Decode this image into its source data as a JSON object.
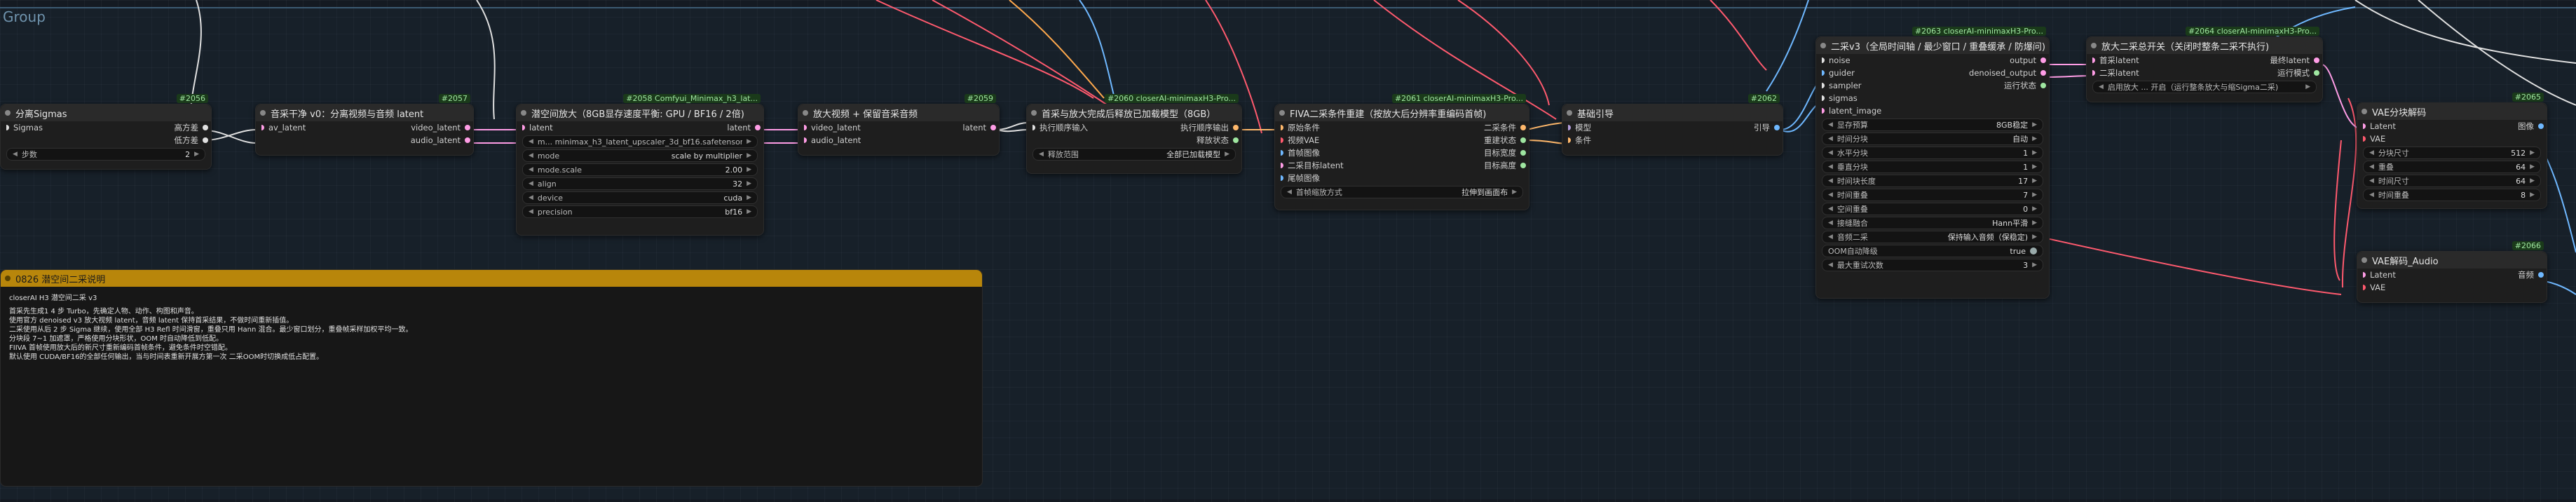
{
  "group": {
    "title": "Group"
  },
  "nodes": {
    "sigmas": {
      "id": "#2056",
      "title": "分离Sigmas",
      "in": "Sigmas",
      "out": [
        "高方差",
        "低方差"
      ],
      "widget": {
        "label": "步数",
        "value": "2"
      }
    },
    "audio_sep": {
      "id": "#2057",
      "title": "音采干净 v0：分离视频与音频 latent",
      "in": "av_latent",
      "out": [
        "video_latent",
        "audio_latent"
      ]
    },
    "upscale": {
      "id": "#2058 Comfyui_Minimax_h3_lat...",
      "title": "潜空间放大（8GB显存速度平衡: GPU / BF16 / 2倍)",
      "in": "latent",
      "out": "latent",
      "widgets": [
        {
          "label": "m... minimax_h3_latent_upscaler_3d_bf16.safetensors",
          "value": ""
        },
        {
          "label": "mode",
          "value": "scale by multiplier"
        },
        {
          "label": "mode.scale",
          "value": "2.00"
        },
        {
          "label": "align",
          "value": "32"
        },
        {
          "label": "device",
          "value": "cuda"
        },
        {
          "label": "precision",
          "value": "bf16"
        }
      ]
    },
    "merge": {
      "id": "#2059",
      "title": "放大视频 + 保留音采音频",
      "in": [
        "video_latent",
        "audio_latent"
      ],
      "out": "latent"
    },
    "unload": {
      "id": "#2060 closerAI-minimaxH3-Pro...",
      "title": "首采与放大完成后释放已加载模型（8GB）",
      "in": "执行顺序输入",
      "out": [
        "执行顺序输出",
        "释放状态"
      ],
      "widget": {
        "label": "释放范围",
        "value": "全部已加载模型"
      }
    },
    "cond": {
      "id": "#2061 closerAI-minimaxH3-Pro...",
      "title": "FIVA二采条件重建（按放大后分辨率重编码首帧)",
      "in": [
        "原始条件",
        "视频VAE",
        "首帧图像",
        "二采目标latent",
        "尾帧图像"
      ],
      "out": [
        "二采条件",
        "重建状态",
        "目标宽度",
        "目标高度"
      ],
      "widget": {
        "label": "首帧缩放方式",
        "value": "拉伸到画面布"
      }
    },
    "guide": {
      "id": "#2062",
      "title": "基础引导",
      "in": [
        "模型",
        "条件"
      ],
      "out": "引导"
    },
    "second": {
      "id": "#2063 closerAI-minimaxH3-Pro...",
      "title": "二采v3（全局时间轴 / 最少窗口 / 重叠缓承 / 防爆问)",
      "in": [
        "noise",
        "guider",
        "sampler",
        "sigmas",
        "latent_image"
      ],
      "out": [
        "output",
        "denoised_output",
        "运行状态"
      ],
      "widgets": [
        {
          "label": "显存预算",
          "value": "8GB稳定"
        },
        {
          "label": "时间分块",
          "value": "自动"
        },
        {
          "label": "水平分块",
          "value": "1"
        },
        {
          "label": "垂直分块",
          "value": "1"
        },
        {
          "label": "时间块长度",
          "value": "17"
        },
        {
          "label": "时间重叠",
          "value": "7"
        },
        {
          "label": "空间重叠",
          "value": "0"
        },
        {
          "label": "接缝融合",
          "value": "Hann平滑"
        },
        {
          "label": "音频二采",
          "value": "保持输入音频（保稳定)"
        },
        {
          "label": "OOM自动降级",
          "value": "true"
        },
        {
          "label": "最大重试次数",
          "value": "3"
        }
      ]
    },
    "switch": {
      "id": "#2064 closerAI-minimaxH3-Pro...",
      "title": "放大二采总开关（关闭时整条二采不执行)",
      "in": [
        "首采latent",
        "二采latent"
      ],
      "out": [
        "最终latent",
        "运行模式"
      ],
      "widget": {
        "label": "启用放大 ... 开启（运行整条放大与缩Sigma二采)",
        "value": ""
      }
    },
    "vae_decode": {
      "id": "#2065",
      "title": "VAE分块解码",
      "in": [
        "Latent",
        "VAE"
      ],
      "out": "图像",
      "widgets": [
        {
          "label": "分块尺寸",
          "value": "512"
        },
        {
          "label": "重叠",
          "value": "64"
        },
        {
          "label": "时间尺寸",
          "value": "64"
        },
        {
          "label": "时间重叠",
          "value": "8"
        }
      ]
    },
    "vae_audio": {
      "id": "#2066",
      "title": "VAE解码_Audio",
      "in": [
        "Latent",
        "VAE"
      ],
      "out": "音频"
    }
  },
  "note": {
    "title": "0826 潜空间二采说明",
    "lines": [
      "closerAI H3 潜空间二采 v3",
      "首采先生成1 4 步 Turbo，先确定人物、动作、构图和声音。",
      "使用官方 denoised v3 放大视频 latent，音频 latent 保持首采结果，不做时间重新插值。",
      "二采使用从后 2 步 Sigma 继续，使用全部 H3 Refl 时间滑窗，重叠只用 Hann 混合。最少窗口划分，重叠帧采样加权平均一致。",
      "分块段 7~1 加遮罩，严格使用分块形状，OOM 时自动降低到低配。",
      "FIIVA 首帧使用放大后的新尺寸重新编码首帧条件，避免条件时空错配。",
      "默认使用 CUDA/BF16的全部任何输出，当与时间表重新开展方第一次 二采OOM时切换成低占配置。"
    ]
  }
}
